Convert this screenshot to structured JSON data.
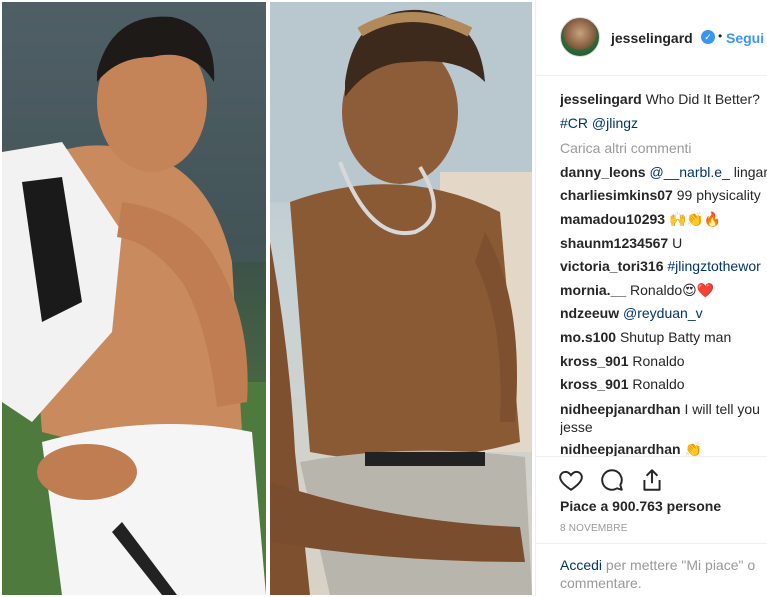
{
  "post": {
    "username": "jesselingard",
    "verified_mark": "✓",
    "separator": "•",
    "follow_label": "Segui",
    "caption_username": "jesselingard",
    "caption_text": "Who Did It Better?",
    "caption_tags": "#CR @jlingz",
    "load_more": "Carica altri commenti",
    "comments": [
      {
        "user": "danny_leons",
        "mention": "@__narbl.e_",
        "text": "lingard"
      },
      {
        "user": "charliesimkins07",
        "text": "99 physicality"
      },
      {
        "user": "mamadou10293",
        "text": "🙌👏🔥"
      },
      {
        "user": "shaunm1234567",
        "text": "U"
      },
      {
        "user": "victoria_tori316",
        "mention": "#jlingztothewor",
        "text": ""
      },
      {
        "user": "mornia.__",
        "text": "Ronaldo😍❤️"
      },
      {
        "user": "ndzeeuw",
        "mention": "@reyduan_v",
        "text": ""
      },
      {
        "user": "mo.s100",
        "text": "Shutup Batty man"
      },
      {
        "user": "kross_901",
        "text": "Ronaldo"
      },
      {
        "user": "kross_901",
        "text": "Ronaldo"
      },
      {
        "user": "nidheepjanardhan",
        "text": "I will tell you jesse"
      },
      {
        "user": "nidheepjanardhan",
        "text": "👏"
      }
    ],
    "likes": "Piace a 900.763 persone",
    "date": "8 NOVEMBRE",
    "login_link": "Accedi",
    "login_text": "per mettere \"Mi piace\" o commentare.",
    "icons": [
      "heart-icon",
      "comment-icon",
      "share-icon"
    ]
  }
}
